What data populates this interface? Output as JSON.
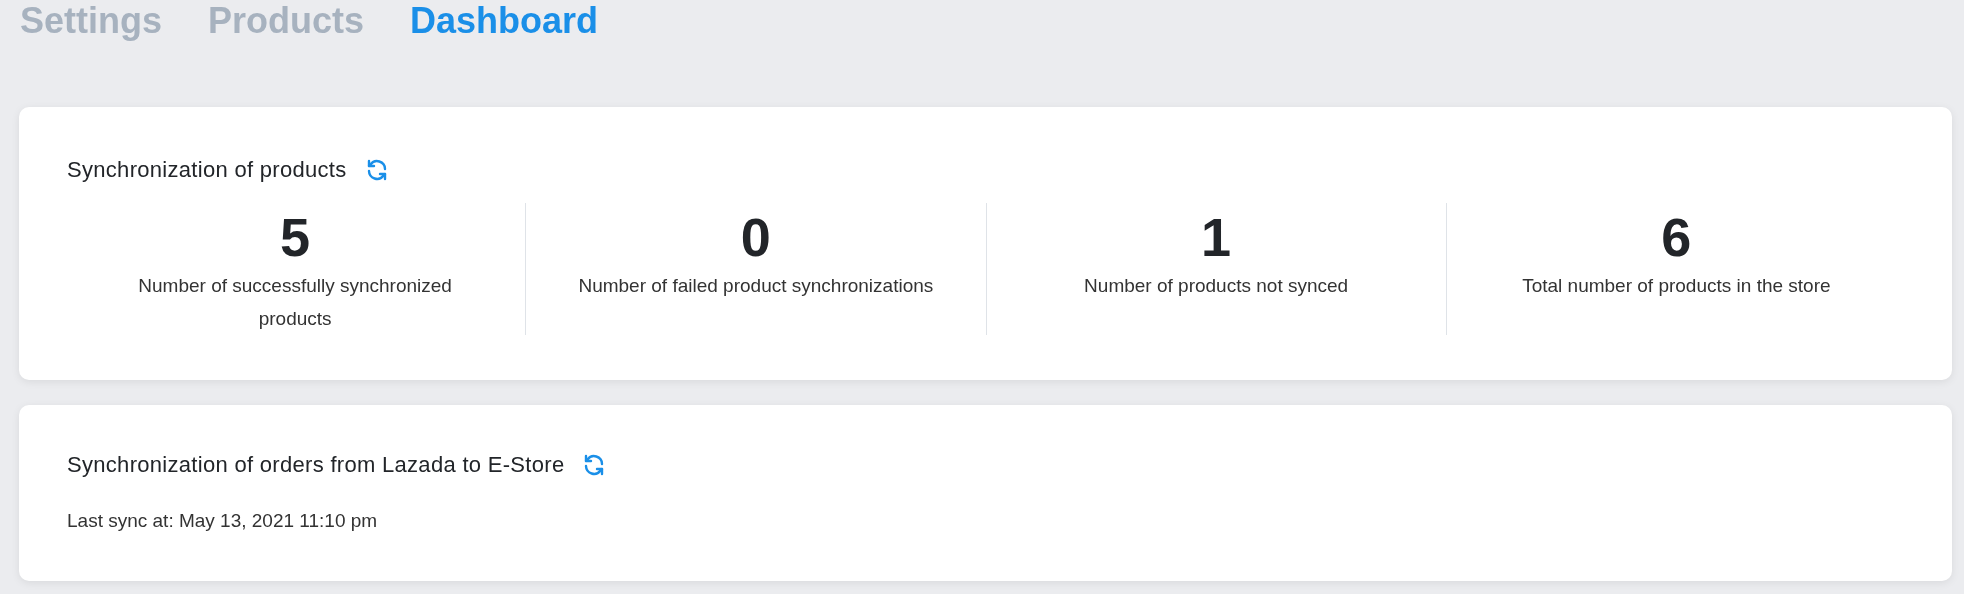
{
  "tabs": [
    {
      "label": "Settings",
      "selected": false
    },
    {
      "label": "Products",
      "selected": false
    },
    {
      "label": "Dashboard",
      "selected": true
    }
  ],
  "products_card": {
    "title": "Synchronization of products",
    "stats": [
      {
        "value": "5",
        "label": "Number of successfully synchronized products"
      },
      {
        "value": "0",
        "label": "Number of failed product synchronizations"
      },
      {
        "value": "1",
        "label": "Number of products not synced"
      },
      {
        "value": "6",
        "label": "Total number of products in the store"
      }
    ]
  },
  "orders_card": {
    "title": "Synchronization of orders from Lazada to E-Store",
    "last_sync": "Last sync at: May 13, 2021 11:10 pm"
  }
}
